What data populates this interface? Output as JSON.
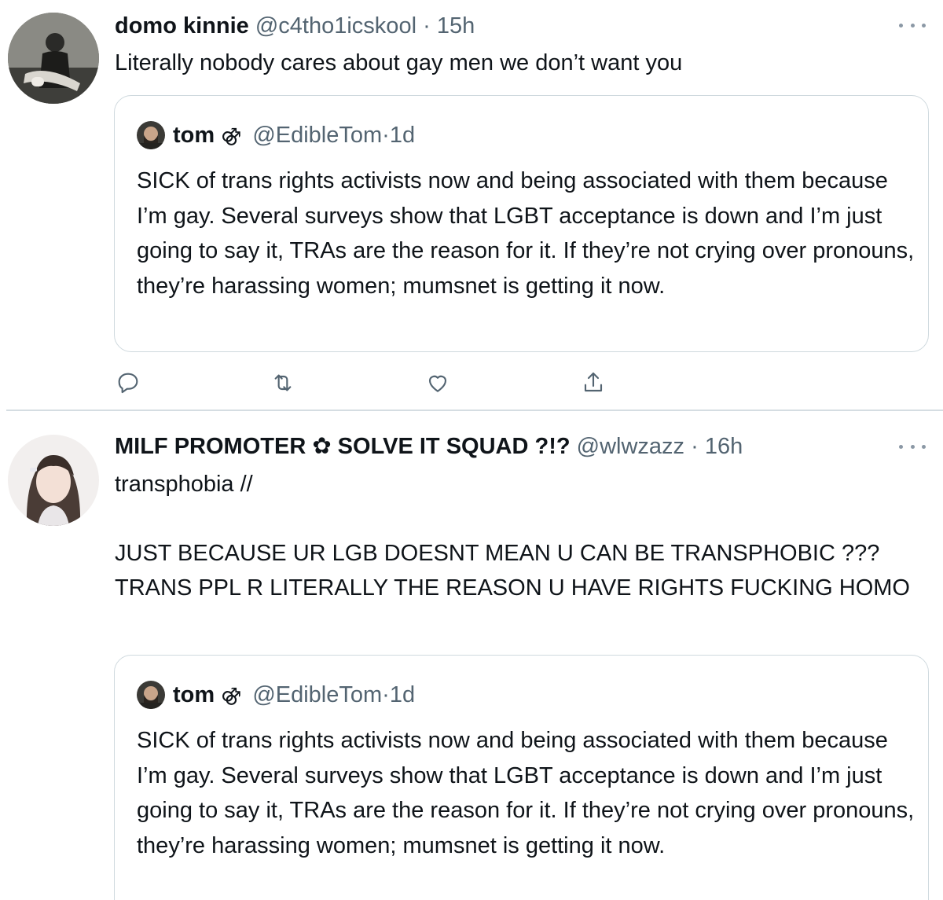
{
  "tweets": [
    {
      "display_name": "domo kinnie",
      "handle": "@c4tho1icskool",
      "separator": "·",
      "time": "15h",
      "text": "Literally nobody cares about gay men we don’t want you",
      "quote": {
        "display_name": "tom",
        "glyph": "⚣",
        "handle": "@EdibleTom",
        "separator": "·",
        "time": "1d",
        "text": "SICK of trans rights activists now and being associated with them because I’m gay. Several surveys show that LGBT acceptance is down and I’m just going to say it, TRAs are the reason for it. If they’re not crying over pronouns, they’re harassing women; mumsnet is getting it now."
      }
    },
    {
      "display_name": "MILF PROMOTER ✿ SOLVE IT SQUAD ?!?",
      "handle": "@wlwzazz",
      "separator": "·",
      "time": "16h",
      "text": "transphobia //\n\nJUST BECAUSE UR LGB DOESNT MEAN U CAN BE TRANSPHOBIC ??? TRANS PPL R LITERALLY THE REASON U HAVE RIGHTS FUCKING HOMO",
      "quote": {
        "display_name": "tom",
        "glyph": "⚣",
        "handle": "@EdibleTom",
        "separator": "·",
        "time": "1d",
        "text": "SICK of trans rights activists now and being associated with them because I’m gay. Several surveys show that LGBT acceptance is down and I’m just going to say it, TRAs are the reason for it. If they’re not crying over pronouns, they’re harassing women; mumsnet is getting it now."
      }
    }
  ],
  "actions": [
    "reply-icon",
    "retweet-icon",
    "like-icon",
    "share-icon"
  ],
  "colors": {
    "text": "#0f1419",
    "secondary": "#536471",
    "border": "#cfd9de",
    "icon": "#536471"
  }
}
